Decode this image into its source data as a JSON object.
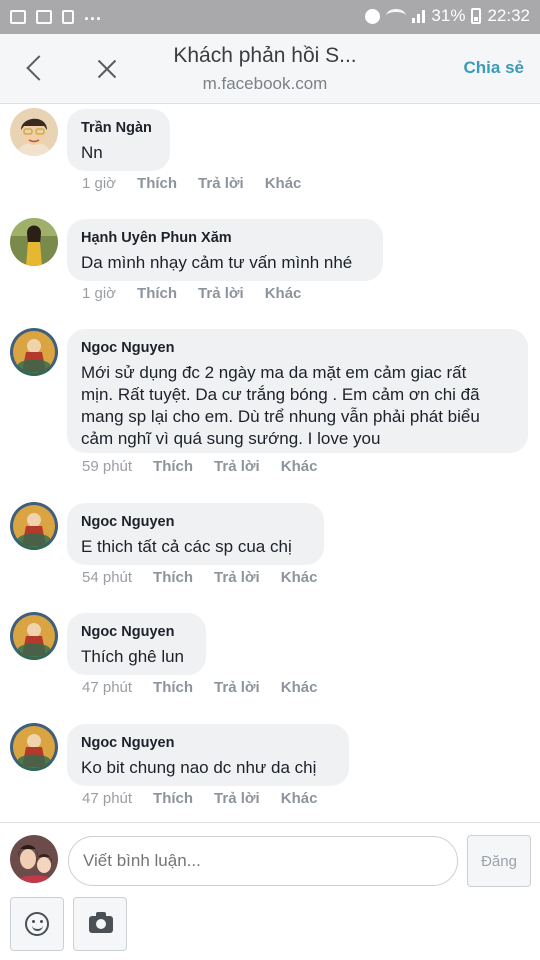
{
  "status_bar": {
    "more_notifications": "...",
    "battery_percent": "31%",
    "time": "22:32"
  },
  "header": {
    "title": "Khách phản hồi S...",
    "url": "m.facebook.com",
    "share_label": "Chia sẻ"
  },
  "comments": [
    {
      "author": "Trần Ngàn",
      "text": "Nn",
      "time": "1 giờ",
      "like": "Thích",
      "reply": "Trả lời",
      "more": "Khác"
    },
    {
      "author": "Hạnh Uyên Phun Xăm",
      "text": "Da mình nhạy cảm tư vấn mình nhé",
      "time": "1 giờ",
      "like": "Thích",
      "reply": "Trả lời",
      "more": "Khác"
    },
    {
      "author": "Ngoc Nguyen",
      "lines": [
        "Mới sử dụng đc 2 ngày ma da mặt em cảm giac rất",
        "mịn. Rất tuyệt. Da cư trắng bóng . Em cảm ơn chi đã",
        "mang sp lại cho em. Dù trể nhung vẫn phải phát biểu",
        "cảm nghĩ vì quá sung sướng. I love you"
      ],
      "time": "59 phút",
      "like": "Thích",
      "reply": "Trả lời",
      "more": "Khác"
    },
    {
      "author": "Ngoc Nguyen",
      "text": "E thich tất cả các sp cua chị",
      "time": "54 phút",
      "like": "Thích",
      "reply": "Trả lời",
      "more": "Khác"
    },
    {
      "author": "Ngoc Nguyen",
      "text": "Thích ghê lun",
      "time": "47 phút",
      "like": "Thích",
      "reply": "Trả lời",
      "more": "Khác"
    },
    {
      "author": "Ngoc Nguyen",
      "text": "Ko bit chung nao dc như da chị",
      "time": "47 phút",
      "like": "Thích",
      "reply": "Trả lời",
      "more": "Khác"
    }
  ],
  "composer": {
    "placeholder": "Viết bình luận...",
    "post_label": "Đăng",
    "emoji_icon": "smiley-icon",
    "camera_icon": "camera-icon"
  },
  "colors": {
    "status_bar": "#a9a9ab",
    "bubble": "#f0f1f3",
    "share_link": "#3c9bb9"
  }
}
